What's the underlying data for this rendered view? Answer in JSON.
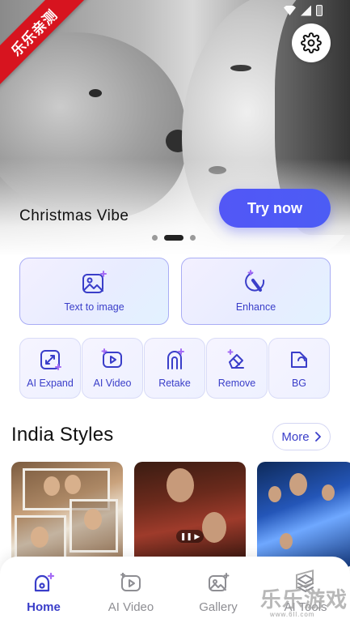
{
  "status_bar": {
    "icons": [
      "wifi-icon",
      "signal-icon",
      "battery-icon"
    ]
  },
  "watermark_ribbon": {
    "text": "乐乐亲测"
  },
  "hero": {
    "title": "Christmas Vibe",
    "cta_label": "Try now",
    "settings_icon": "gear-icon",
    "carousel_pages": 3,
    "carousel_active_index": 1
  },
  "features": {
    "primary": [
      {
        "label": "Text to image",
        "icon": "image-sparkle-icon"
      },
      {
        "label": "Enhance",
        "icon": "magic-wand-icon"
      }
    ],
    "secondary": [
      {
        "label": "AI Expand",
        "icon": "expand-icon"
      },
      {
        "label": "AI Video",
        "icon": "video-icon"
      },
      {
        "label": "Retake",
        "icon": "retake-icon"
      },
      {
        "label": "Remove",
        "icon": "eraser-icon"
      },
      {
        "label": "BG",
        "icon": "background-icon"
      }
    ]
  },
  "section": {
    "title": "India Styles",
    "more_label": "More"
  },
  "bottom_nav": [
    {
      "label": "Home",
      "icon": "home-sparkle-icon",
      "active": true
    },
    {
      "label": "AI Video",
      "icon": "video-icon",
      "active": false
    },
    {
      "label": "Gallery",
      "icon": "gallery-icon",
      "active": false
    },
    {
      "label": "AI Tools",
      "icon": "tools-icon",
      "active": false
    }
  ],
  "site_watermark": {
    "text": "乐乐游戏",
    "url": "www.6ll.com"
  },
  "colors": {
    "accent": "#3a3ec9",
    "cta": "#5257f6",
    "ribbon": "#d7141f"
  }
}
